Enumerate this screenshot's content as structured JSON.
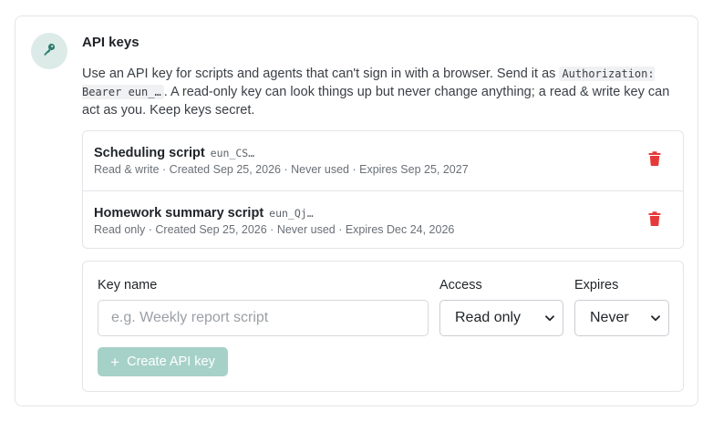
{
  "section": {
    "title": "API keys",
    "icon": "key-icon",
    "accent_color": "#2f7d6d",
    "description": {
      "before": "Use an API key for scripts and agents that can't sign in with a browser. Send it as ",
      "code": "Authorization: Bearer eun_…",
      "after": ". A read-only key can look things up but never change anything; a read & write key can act as you. Keep keys secret."
    }
  },
  "keys": [
    {
      "name": "Scheduling script",
      "prefix": "eun_CS…",
      "meta": "Read & write · Created Sep 25, 2026 · Never used · Expires Sep 25, 2027",
      "delete_icon": "trash-icon"
    },
    {
      "name": "Homework summary script",
      "prefix": "eun_Qj…",
      "meta": "Read only · Created Sep 25, 2026 · Never used · Expires Dec 24, 2026",
      "delete_icon": "trash-icon"
    }
  ],
  "create_form": {
    "name_label": "Key name",
    "name_placeholder": "e.g. Weekly report script",
    "name_value": "",
    "access_label": "Access",
    "access_value": "Read only",
    "expires_label": "Expires",
    "expires_value": "Never",
    "submit_label": "Create API key"
  },
  "colors": {
    "danger": "#e5393b",
    "button_disabled": "#a6d1c8",
    "badge_bg": "#dcebe7"
  }
}
